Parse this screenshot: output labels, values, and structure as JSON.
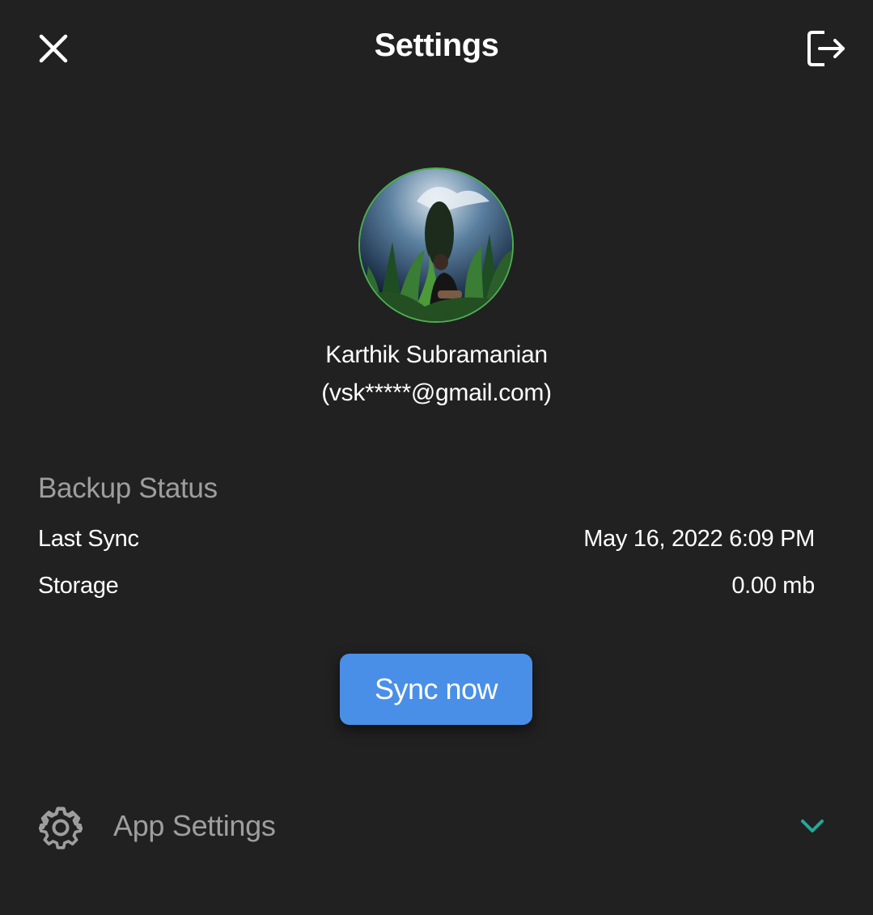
{
  "header": {
    "title": "Settings",
    "close_icon": "close-icon",
    "logout_icon": "logout-icon"
  },
  "profile": {
    "name": "Karthik Subramanian",
    "email": "(vsk*****@gmail.com)",
    "avatar_ring_color": "#4caf50"
  },
  "backup": {
    "section_title": "Backup Status",
    "last_sync_label": "Last Sync",
    "last_sync_value": "May 16, 2022 6:09 PM",
    "storage_label": "Storage",
    "storage_value": "0.00 mb"
  },
  "sync_button": {
    "label": "Sync now",
    "color": "#4a8fe7"
  },
  "app_settings": {
    "label": "App Settings",
    "icon": "gear-icon",
    "expand_icon": "chevron-down-icon",
    "accent_color": "#26a69a"
  },
  "theme": {
    "background": "#212121",
    "text_primary": "#ffffff",
    "text_secondary": "#9e9e9e"
  }
}
